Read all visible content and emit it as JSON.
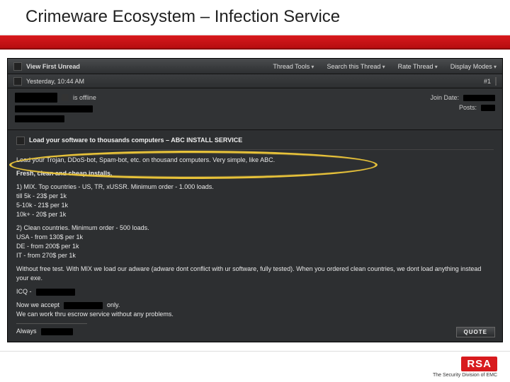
{
  "slide": {
    "title": "Crimeware Ecosystem – Infection Service"
  },
  "toolbar": {
    "view_first_unread": "View First Unread",
    "thread_tools": "Thread Tools",
    "search_thread": "Search this Thread",
    "rate_thread": "Rate Thread",
    "display_modes": "Display Modes"
  },
  "postbar": {
    "timestamp": "Yesterday, 10:44 AM",
    "index": "#1"
  },
  "userinfo": {
    "offline_text": "is offline",
    "join_label": "Join Date:",
    "posts_label": "Posts:"
  },
  "post": {
    "title_prefix": "Load your software to thousands computers – ",
    "title_caps": "ABC install service",
    "lead": "Load your Trojan, DDoS-bot, Spam-bot, etc. on thousand computers. Very simple, like ABC.",
    "fresh": "Fresh, clean and cheap installs.",
    "mix_header": "1) MIX. Top countries - US, TR, xUSSR. Minimum order - 1.000 loads.",
    "mix_l1": "till 5k - 23$ per 1k",
    "mix_l2": "5-10k - 21$ per 1k",
    "mix_l3": "10k+ - 20$ per 1k",
    "clean_header": "2) Clean countries. Minimum order - 500 loads.",
    "clean_l1": "USA - from 130$ per 1k",
    "clean_l2": "DE - from 200$ per 1k",
    "clean_l3": "IT - from 270$ per 1k",
    "note": "Without free test. With MIX we load our adware (adware dont conflict with ur software, fully tested). When you ordered clean countries, we dont load anything instead your exe.",
    "icq_prefix": "ICQ - ",
    "accept_prefix": "Now we accept ",
    "accept_suffix": " only.",
    "escrow": "We can work thru escrow service without any problems.",
    "always": "Always "
  },
  "buttons": {
    "quote": "Quote"
  },
  "footer": {
    "logo_text": "RSA",
    "tagline": "The Security Division of EMC"
  }
}
